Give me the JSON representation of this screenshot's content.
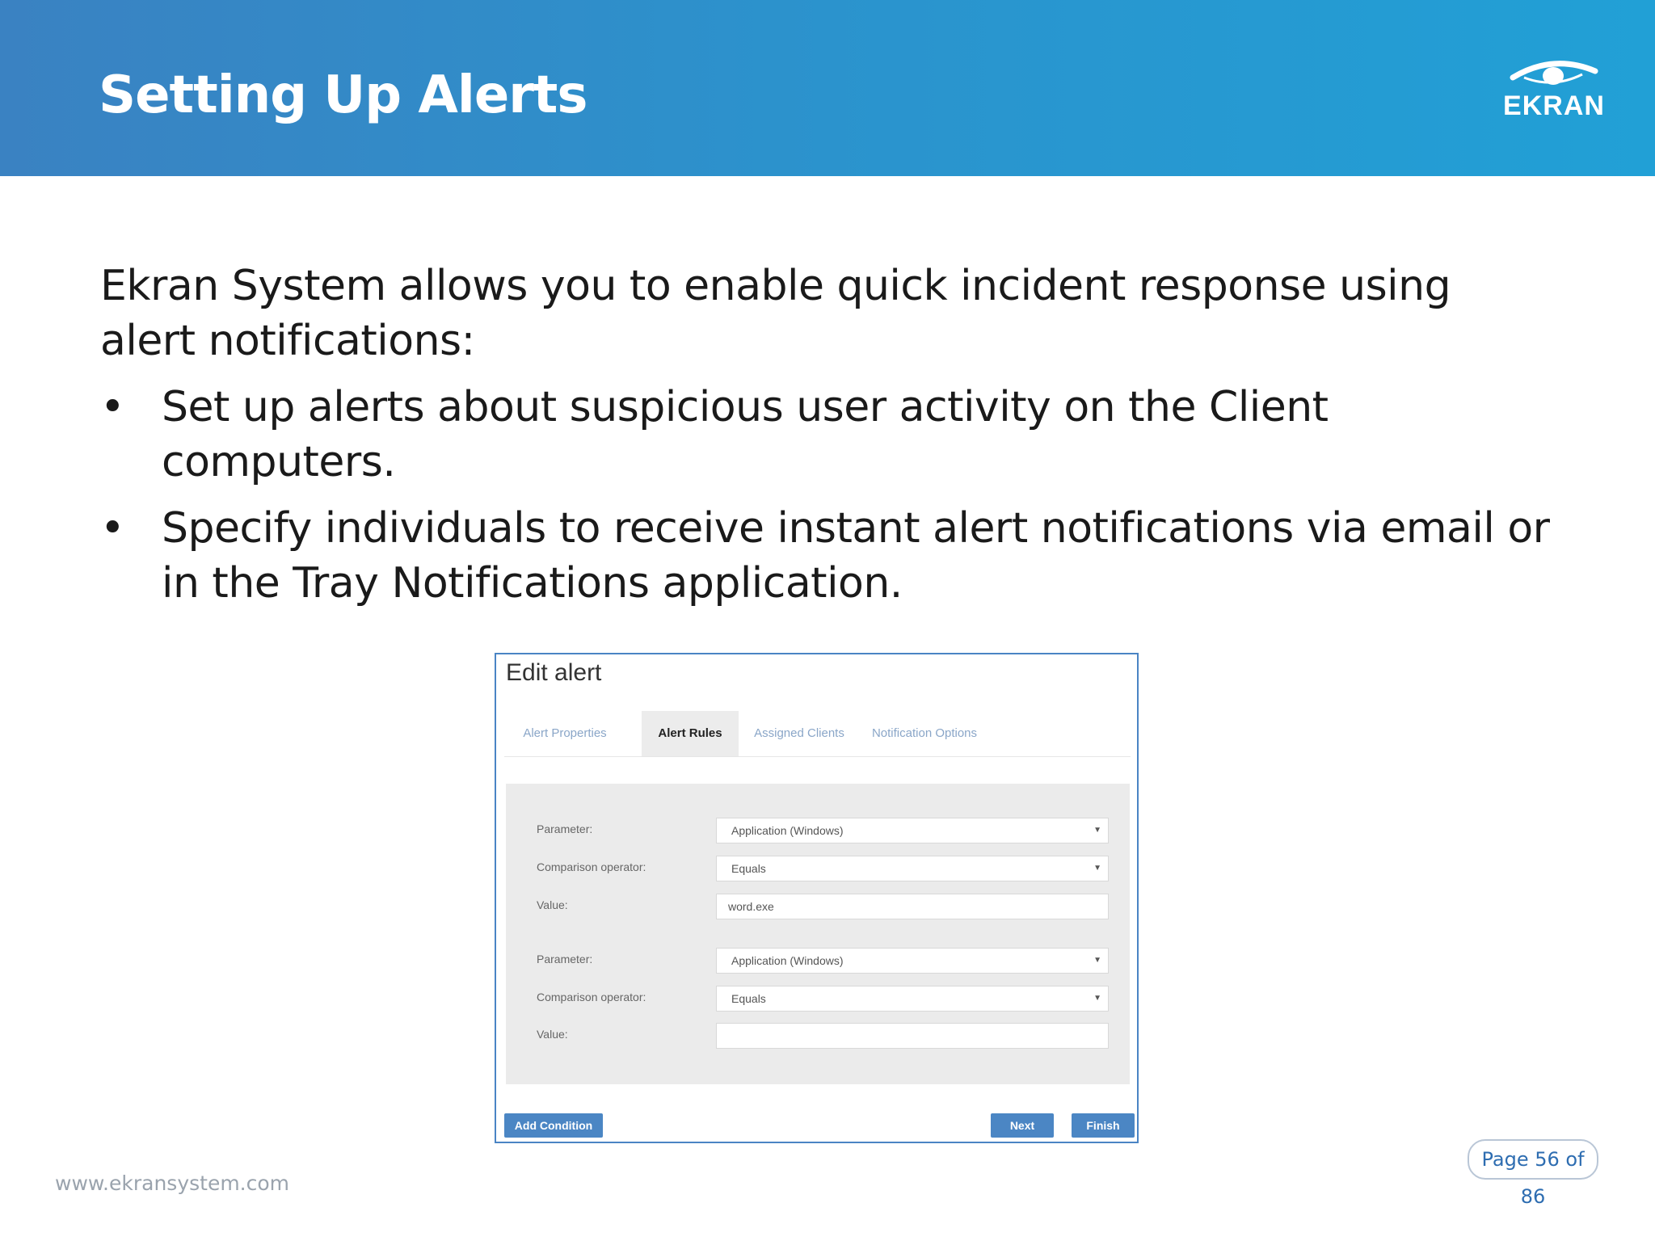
{
  "header": {
    "title": "Setting Up Alerts",
    "logo_text": "EKRAN"
  },
  "content": {
    "intro": "Ekran System allows you to enable quick incident response using alert notifications:",
    "bullets": [
      "Set up alerts about suspicious user activity on the Client computers.",
      "Specify individuals to receive instant alert notifications via email or in the Tray Notifications application."
    ]
  },
  "dialog": {
    "title": "Edit alert",
    "tabs": [
      {
        "label": "Alert Properties",
        "active": false
      },
      {
        "label": "Alert Rules",
        "active": true
      },
      {
        "label": "Assigned Clients",
        "active": false
      },
      {
        "label": "Notification Options",
        "active": false
      }
    ],
    "conditions": [
      {
        "parameter_label": "Parameter:",
        "parameter_value": "Application (Windows)",
        "operator_label": "Comparison operator:",
        "operator_value": "Equals",
        "value_label": "Value:",
        "value": "word.exe"
      },
      {
        "parameter_label": "Parameter:",
        "parameter_value": "Application (Windows)",
        "operator_label": "Comparison operator:",
        "operator_value": "Equals",
        "value_label": "Value:",
        "value": ""
      }
    ],
    "buttons": {
      "add_condition": "Add Condition",
      "next": "Next",
      "finish": "Finish"
    }
  },
  "footer": {
    "url": "www.ekransystem.com",
    "page": "Page 56 of 86"
  },
  "colors": {
    "header_gradient_start": "#3a82c2",
    "header_gradient_end": "#21a0d6",
    "button_blue": "#4b86c4",
    "page_number_text": "#2e6db1"
  }
}
